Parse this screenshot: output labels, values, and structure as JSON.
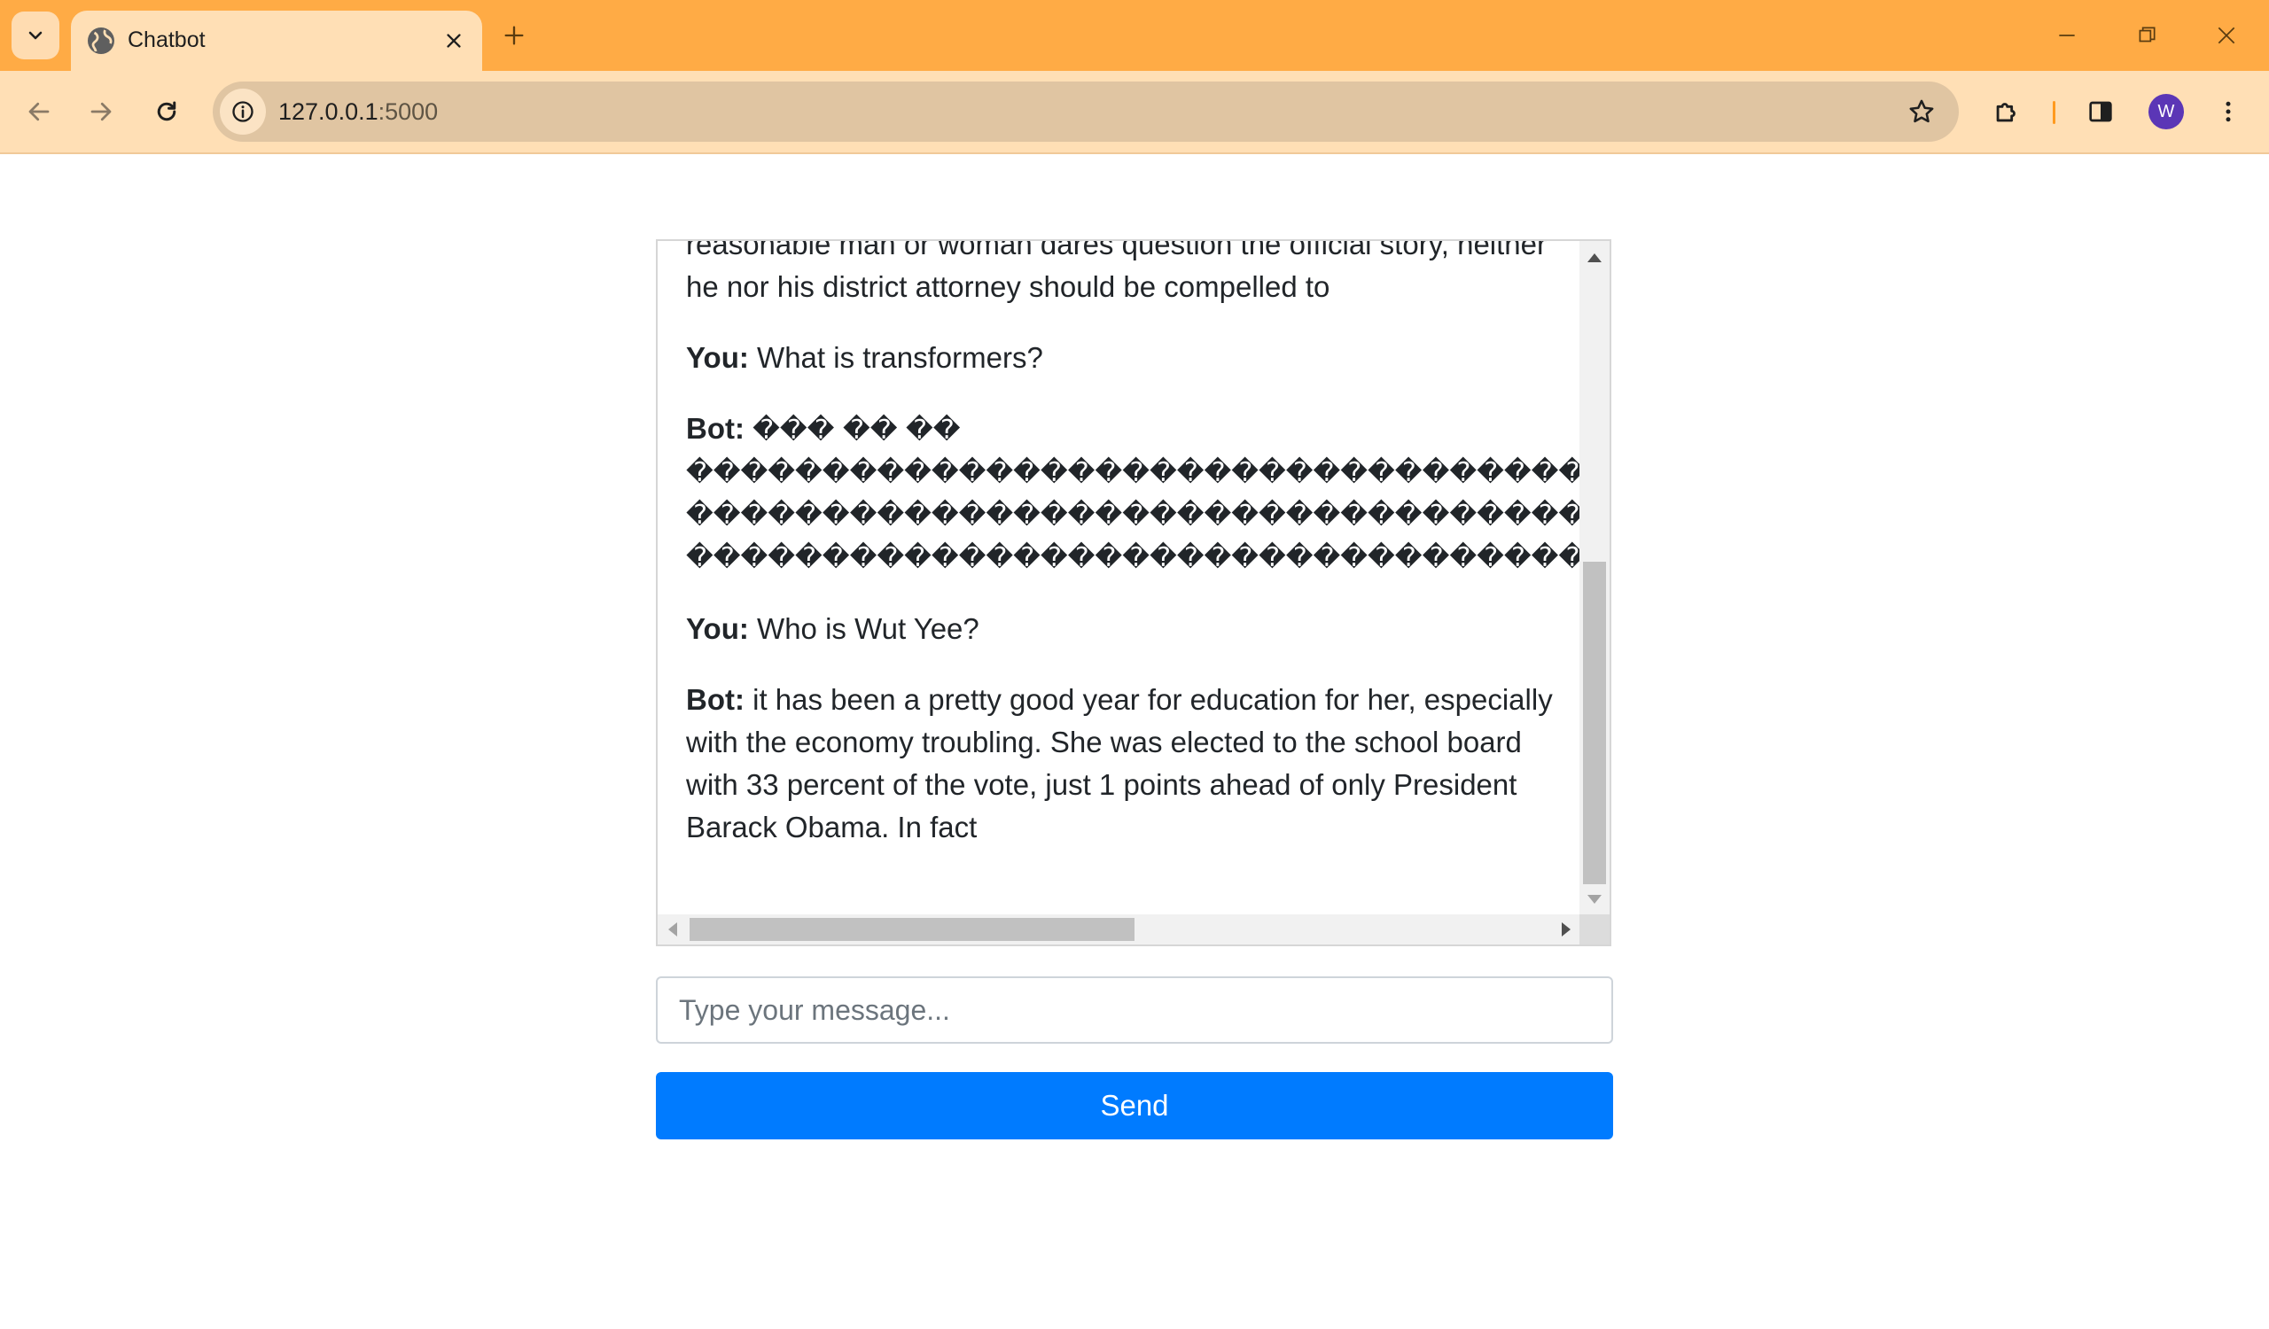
{
  "browser": {
    "tab_title": "Chatbot",
    "url_host": "127.0.0.1",
    "url_port": ":5000",
    "profile_initial": "W",
    "accent_color": "#ffab45"
  },
  "chat": {
    "messages": [
      {
        "speaker": "",
        "text": "reasonable man or woman dares question the official story, neither he nor his district attorney should be compelled to"
      },
      {
        "speaker": "You:",
        "text": "What is transformers?"
      },
      {
        "speaker": "Bot:",
        "text_lines": [
          "��� �� ��",
          "��������������������������������������������������",
          "��������������������������������������������������",
          "��������������������������������������������������"
        ]
      },
      {
        "speaker": "You:",
        "text": "Who is Wut Yee?"
      },
      {
        "speaker": "Bot:",
        "text": "it has been a pretty good year for education for her, especially with the economy troubling. She was elected to the school board with 33 percent of the vote, just 1 points ahead of only  President Barack Obama. In fact"
      }
    ]
  },
  "input": {
    "placeholder": "Type your message...",
    "value": ""
  },
  "send_button": {
    "label": "Send",
    "color": "#007bff"
  }
}
